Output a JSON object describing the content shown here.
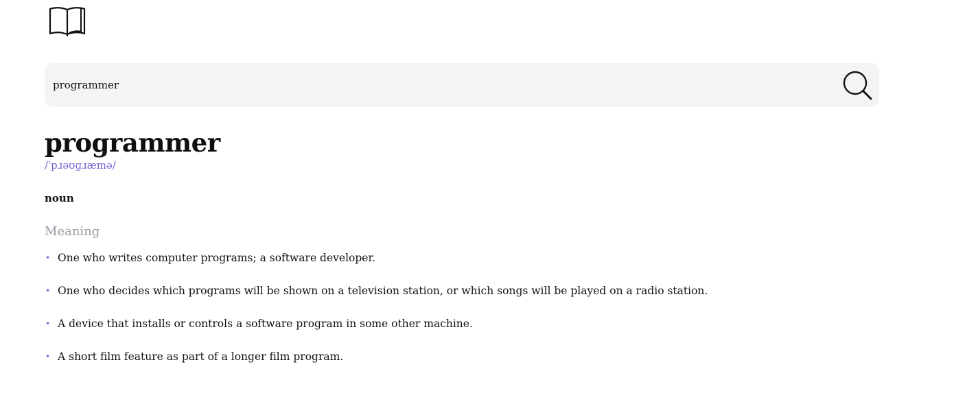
{
  "app": {
    "logo_icon": "open-book-icon"
  },
  "search": {
    "value": "programmer",
    "button_icon": "magnifier-icon"
  },
  "entry": {
    "word": "programmer",
    "phonetic": "/ˈpɹəʊɡɹæmə/",
    "part_of_speech": "noun",
    "meaning_heading": "Meaning",
    "meanings": [
      "One who writes computer programs; a software developer.",
      "One who decides which programs will be shown on a television station, or which songs will be played on a radio station.",
      "A device that installs or controls a software program in some other machine.",
      "A short film feature as part of a longer film program."
    ]
  },
  "colors": {
    "accent": "#7a63d8",
    "muted_heading": "#9a9aa6",
    "search_background": "#f4f4f4"
  }
}
